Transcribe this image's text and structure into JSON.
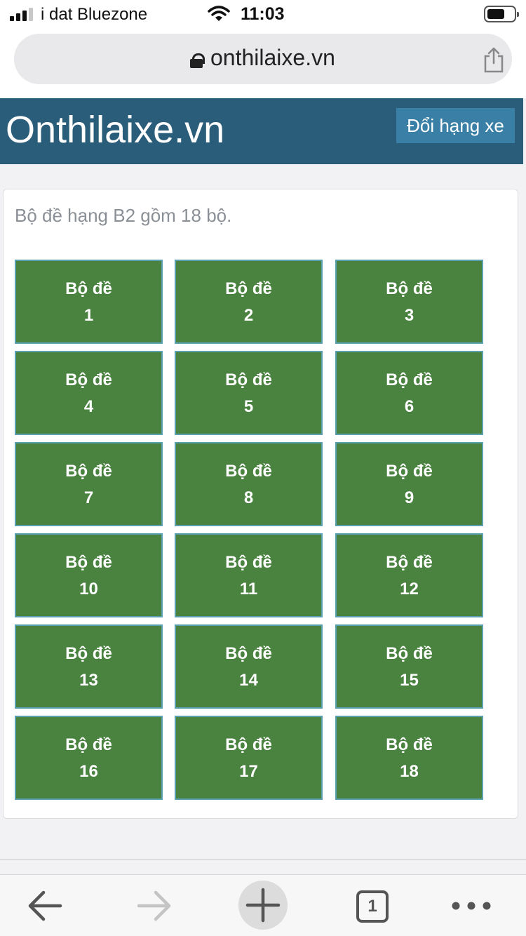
{
  "status_bar": {
    "carrier": "i dat Bluezone",
    "time": "11:03"
  },
  "browser": {
    "url": "onthilaixe.vn"
  },
  "header": {
    "site_title": "Onthilaixe.vn",
    "switch_button": "Đổi hạng xe"
  },
  "main": {
    "intro": "Bộ đề hạng B2 gồm 18 bộ.",
    "sets": [
      {
        "label": "Bộ đề",
        "number": "1"
      },
      {
        "label": "Bộ đề",
        "number": "2"
      },
      {
        "label": "Bộ đề",
        "number": "3"
      },
      {
        "label": "Bộ đề",
        "number": "4"
      },
      {
        "label": "Bộ đề",
        "number": "5"
      },
      {
        "label": "Bộ đề",
        "number": "6"
      },
      {
        "label": "Bộ đề",
        "number": "7"
      },
      {
        "label": "Bộ đề",
        "number": "8"
      },
      {
        "label": "Bộ đề",
        "number": "9"
      },
      {
        "label": "Bộ đề",
        "number": "10"
      },
      {
        "label": "Bộ đề",
        "number": "11"
      },
      {
        "label": "Bộ đề",
        "number": "12"
      },
      {
        "label": "Bộ đề",
        "number": "13"
      },
      {
        "label": "Bộ đề",
        "number": "14"
      },
      {
        "label": "Bộ đề",
        "number": "15"
      },
      {
        "label": "Bộ đề",
        "number": "16"
      },
      {
        "label": "Bộ đề",
        "number": "17"
      },
      {
        "label": "Bộ đề",
        "number": "18"
      }
    ]
  },
  "toolbar": {
    "tab_count": "1",
    "icons": [
      "back-arrow-icon",
      "forward-arrow-icon",
      "new-tab-plus-icon",
      "tabs-icon",
      "more-dots-icon"
    ]
  },
  "colors": {
    "header_bg": "#2a5d79",
    "switch_button_bg": "#3a7fa6",
    "tile_bg": "#4a8240",
    "tile_border": "#5aa0b0"
  }
}
